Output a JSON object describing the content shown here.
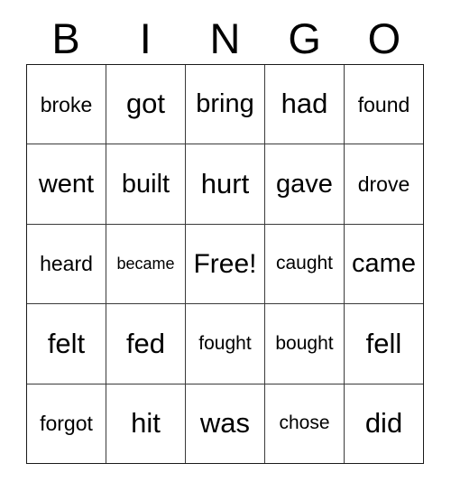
{
  "card": {
    "title": "BINGO",
    "header_letters": [
      "B",
      "I",
      "N",
      "G",
      "O"
    ],
    "free_space_label": "Free!",
    "colors": {
      "background": "#ffffff",
      "text": "#000000",
      "grid_line": "#3a3a3a",
      "outer_border": "#1a1a1a"
    },
    "grid": {
      "columns": 5,
      "rows": 5,
      "cells": [
        [
          {
            "text": "broke",
            "size": "sz-md"
          },
          {
            "text": "got",
            "size": "sz-xl"
          },
          {
            "text": "bring",
            "size": "sz-lg"
          },
          {
            "text": "had",
            "size": "sz-xl"
          },
          {
            "text": "found",
            "size": "sz-md"
          }
        ],
        [
          {
            "text": "went",
            "size": "sz-lg"
          },
          {
            "text": "built",
            "size": "sz-lg"
          },
          {
            "text": "hurt",
            "size": "sz-xl"
          },
          {
            "text": "gave",
            "size": "sz-lg"
          },
          {
            "text": "drove",
            "size": "sz-md"
          }
        ],
        [
          {
            "text": "heard",
            "size": "sz-md"
          },
          {
            "text": "became",
            "size": "sz-xs"
          },
          {
            "text": "Free!",
            "size": "sz-free"
          },
          {
            "text": "caught",
            "size": "sz-sm"
          },
          {
            "text": "came",
            "size": "sz-lg"
          }
        ],
        [
          {
            "text": "felt",
            "size": "sz-xl"
          },
          {
            "text": "fed",
            "size": "sz-xl"
          },
          {
            "text": "fought",
            "size": "sz-sm"
          },
          {
            "text": "bought",
            "size": "sz-sm"
          },
          {
            "text": "fell",
            "size": "sz-xl"
          }
        ],
        [
          {
            "text": "forgot",
            "size": "sz-md"
          },
          {
            "text": "hit",
            "size": "sz-xl"
          },
          {
            "text": "was",
            "size": "sz-xl"
          },
          {
            "text": "chose",
            "size": "sz-sm"
          },
          {
            "text": "did",
            "size": "sz-xl"
          }
        ]
      ]
    }
  }
}
